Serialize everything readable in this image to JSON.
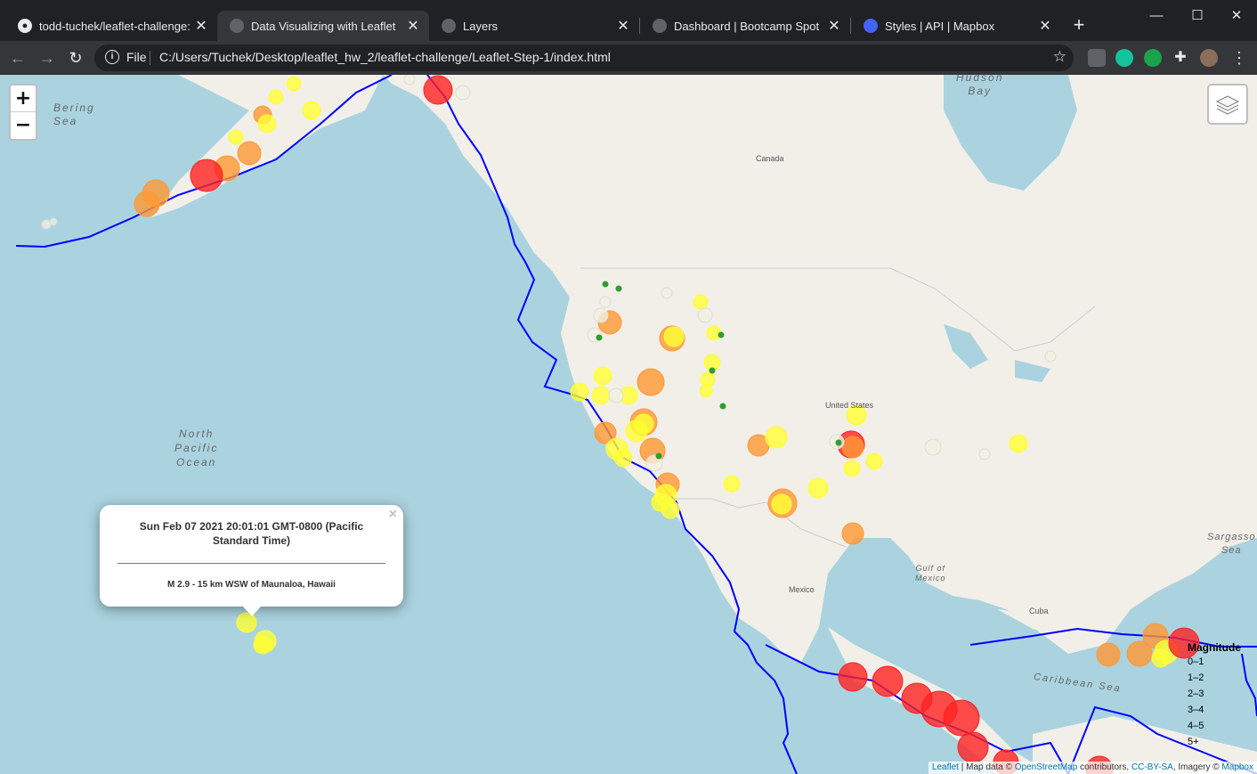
{
  "tabs": [
    {
      "title": "todd-tuchek/leaflet-challenge: Le",
      "favicon": "github-icon",
      "active": false
    },
    {
      "title": "Data Visualizing with Leaflet",
      "favicon": "globe-icon",
      "active": true
    },
    {
      "title": "Layers",
      "favicon": "globe-icon",
      "active": false
    },
    {
      "title": "Dashboard | Bootcamp Spot",
      "favicon": "globe-icon",
      "active": false
    },
    {
      "title": "Styles | API | Mapbox",
      "favicon": "mapbox-icon",
      "active": false
    }
  ],
  "toolbar": {
    "scheme": "File",
    "url": "C:/Users/Tuchek/Desktop/leaflet_hw_2/leaflet-challenge/Leaflet-Step-1/index.html"
  },
  "map": {
    "zoom_in": "+",
    "zoom_out": "−",
    "labels": {
      "bering": "Bering\nSea",
      "north_pacific": "North\nPacific\nOcean",
      "hudson": "Hudson\nBay",
      "canada": "Canada",
      "united_states": "United States",
      "mexico": "Mexico",
      "gulf": "Gulf of\nMexico",
      "caribbean": "Caribbean Sea",
      "sargasso": "Sargasso\nSea",
      "cuba": "Cuba"
    },
    "popup": {
      "time": "Sun Feb 07 2021 20:01:01 GMT-0800 (Pacific Standard Time)",
      "place": "M 2.9 - 15 km WSW of Maunaloa, Hawaii",
      "close": "×"
    },
    "legend": {
      "title": "Magnitude",
      "items": [
        "0–1",
        "1–2",
        "2–3",
        "3–4",
        "4–5",
        "5+"
      ]
    },
    "attribution": {
      "leaflet": "Leaflet",
      "text1": " | Map data © ",
      "osm": "OpenStreetMap",
      "text2": " contributors, ",
      "ccbysa": "CC-BY-SA",
      "text3": ", Imagery © ",
      "mapbox": "Mapbox"
    },
    "colors": {
      "m0_1": "#f0f0e0",
      "m1_2": "#2e9e2e",
      "m2_3": "#ffff33",
      "m3_4": "#ffff33",
      "m4_5": "#ff9933",
      "m5": "#ff2222",
      "plates": "#0000ff"
    }
  }
}
